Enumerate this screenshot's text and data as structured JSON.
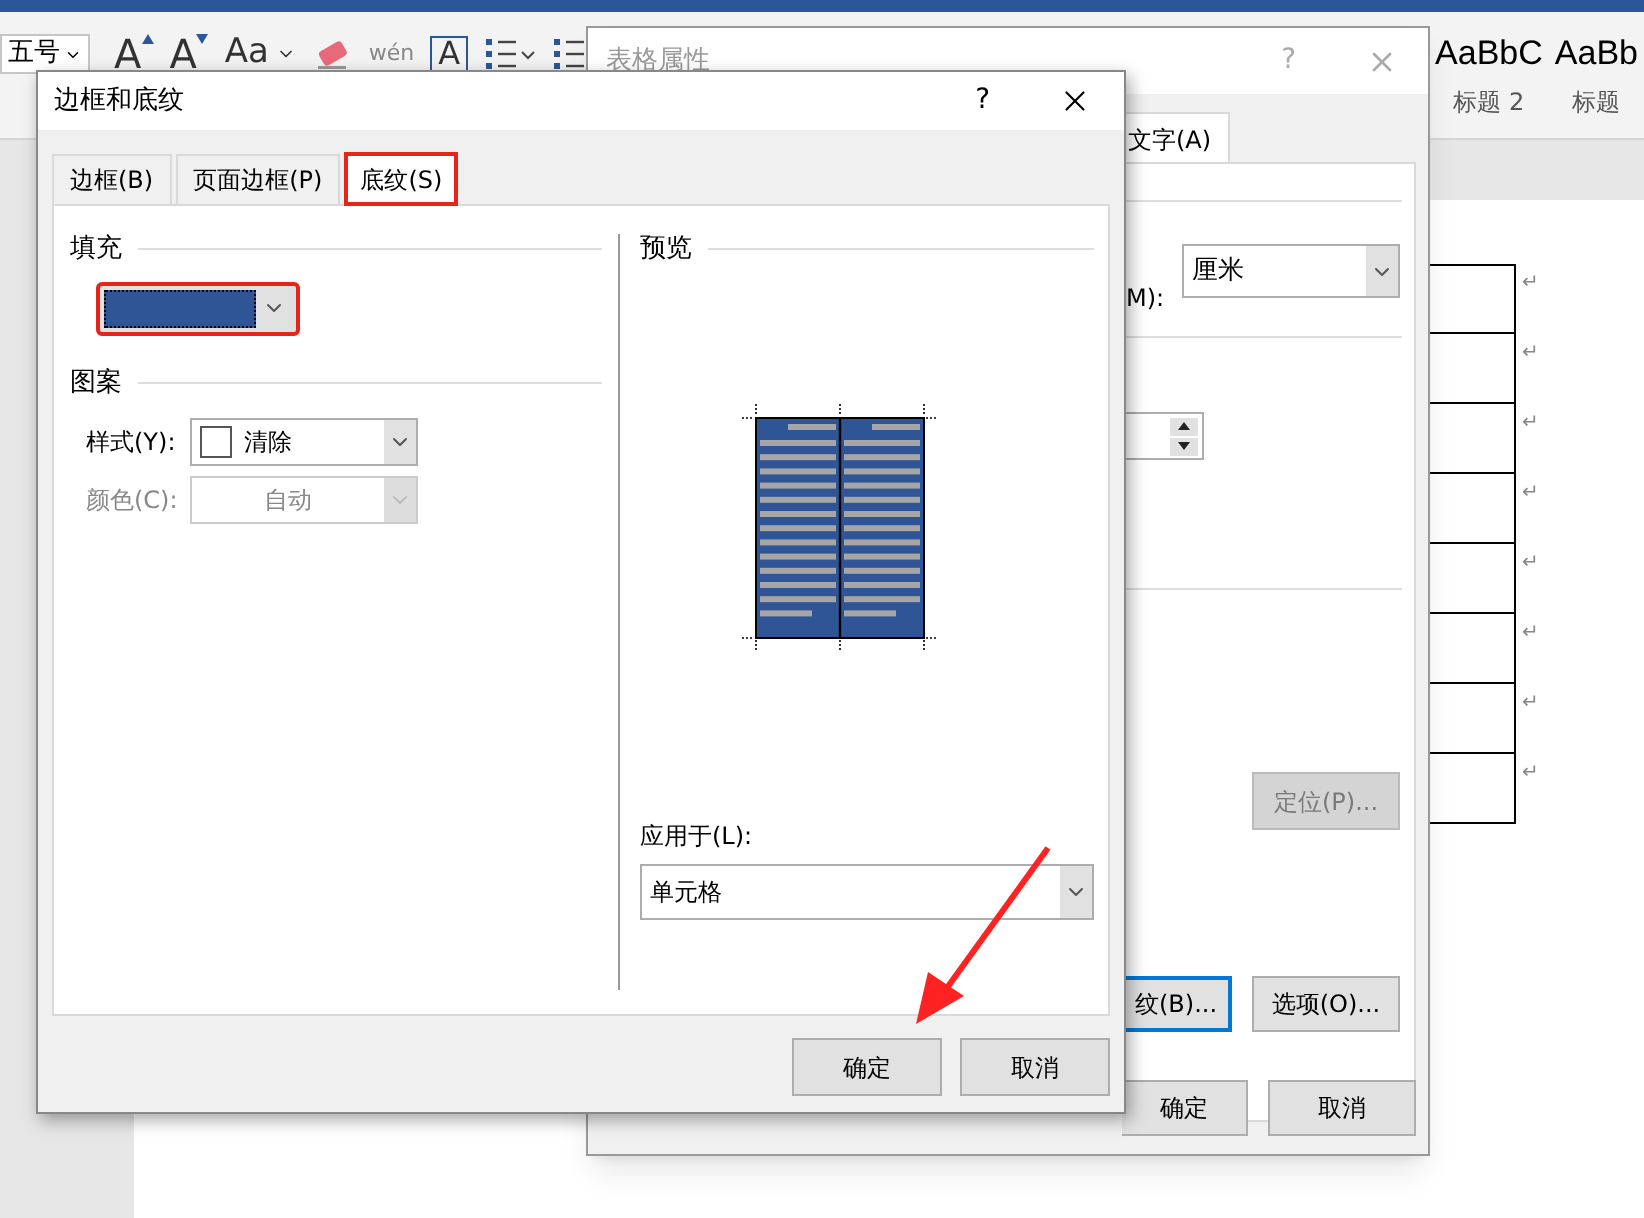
{
  "ribbon": {
    "font_size": "五号",
    "buttons": [
      {
        "kind": "grow",
        "label": "A"
      },
      {
        "kind": "shrink",
        "label": "A"
      },
      {
        "kind": "case",
        "label": "Aa"
      },
      {
        "kind": "eraser"
      },
      {
        "kind": "phonetic",
        "label": "wén"
      },
      {
        "kind": "boxed",
        "label": "A"
      },
      {
        "kind": "bullets"
      },
      {
        "kind": "numbering"
      }
    ],
    "styles": [
      {
        "sample": "AaBbC",
        "name": "标题 2"
      },
      {
        "sample": "AaBb",
        "name": "标题"
      }
    ]
  },
  "document": {
    "table_rows": [
      {
        "mark": "↵"
      },
      {
        "mark": "↵"
      },
      {
        "mark": "↵"
      },
      {
        "mark": "↵"
      },
      {
        "mark": "↵"
      },
      {
        "mark": "↵"
      },
      {
        "mark": "↵"
      },
      {
        "mark": "↵"
      }
    ]
  },
  "back_dialog": {
    "title": "表格属性",
    "help": "?",
    "tab": {
      "label": "文字(A)",
      "selected": true
    },
    "unit_label": "M):",
    "unit_value": "厘米",
    "position_button": {
      "label": "定位(P)...",
      "disabled": true
    },
    "shading_button": {
      "label": "纹(B)...",
      "focused": true
    },
    "options_button": {
      "label": "选项(O)...",
      "focused": false
    },
    "ok": "确定",
    "cancel": "取消"
  },
  "dialog": {
    "title": "边框和底纹",
    "help": "?",
    "tabs": [
      {
        "label": "边框(B)",
        "selected": false,
        "highlighted": false
      },
      {
        "label": "页面边框(P)",
        "selected": false,
        "highlighted": false
      },
      {
        "label": "底纹(S)",
        "selected": true,
        "highlighted": true
      }
    ],
    "fill": {
      "heading": "填充",
      "color": "#2f5597",
      "highlighted": true
    },
    "pattern": {
      "heading": "图案",
      "fields": [
        {
          "label": "样式(Y):",
          "value": "清除",
          "disabled": false,
          "swatch": true
        },
        {
          "label": "颜色(C):",
          "value": "自动",
          "disabled": true,
          "swatch": false
        }
      ]
    },
    "preview": {
      "heading": "预览"
    },
    "apply_to": {
      "label": "应用于(L):",
      "value": "单元格"
    },
    "buttons": [
      "确定",
      "取消"
    ]
  },
  "annotation": {
    "arrow": true
  }
}
